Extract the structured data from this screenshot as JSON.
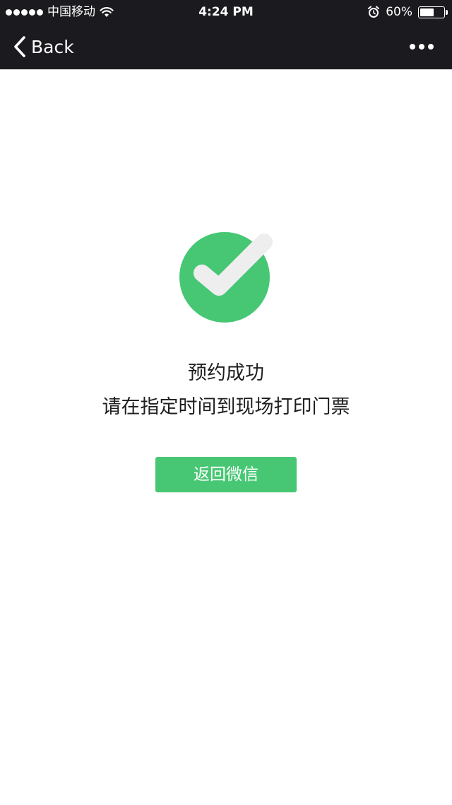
{
  "status_bar": {
    "carrier": "中国移动",
    "time": "4:24 PM",
    "battery_percent": "60%",
    "battery_level": 0.6,
    "signal_dots": 5,
    "icons": [
      "wifi-icon",
      "alarm-icon",
      "battery-icon"
    ]
  },
  "nav": {
    "back_label": "Back",
    "back_icon": "chevron-left-icon",
    "more_icon": "more-dots-icon"
  },
  "main": {
    "success_icon": "check-circle-icon",
    "title": "预约成功",
    "subtitle": "请在指定时间到现场打印门票",
    "return_button_label": "返回微信"
  },
  "colors": {
    "topbar_bg": "#1b1a1f",
    "accent_green": "#47c774",
    "check_stroke": "#eeeeee",
    "text": "#1f1f1f",
    "background": "#ffffff"
  }
}
